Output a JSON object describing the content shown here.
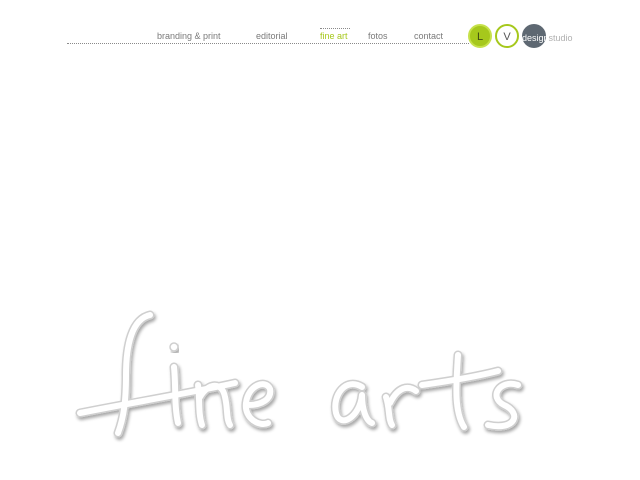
{
  "nav": {
    "items": [
      {
        "label": "branding & print"
      },
      {
        "label": "editorial"
      },
      {
        "label": "fine art",
        "active": true
      },
      {
        "label": "fotos"
      },
      {
        "label": "contact"
      }
    ],
    "active_color": "#a6c81c",
    "text_color": "#7a7a7a"
  },
  "logo": {
    "letter1": "L",
    "letter2": "V",
    "word1": "design",
    "word2": "studio",
    "green": "#a6c81c",
    "slate": "#5e6872"
  },
  "hero": {
    "text": "fine arts"
  }
}
